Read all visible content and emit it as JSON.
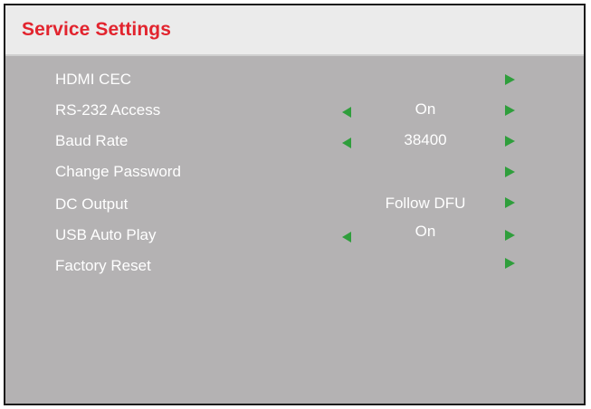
{
  "window": {
    "title": "Service Settings"
  },
  "colors": {
    "title": "#e2242e",
    "header_bg": "#ebebeb",
    "panel_bg": "#b4b2b3",
    "arrow": "#2f9e3c",
    "text": "#ffffff"
  },
  "menu": {
    "items": [
      {
        "label": "HDMI CEC",
        "value": "",
        "left_arrow": false,
        "right_arrow": true
      },
      {
        "label": "RS-232 Access",
        "value": "On",
        "left_arrow": true,
        "right_arrow": true
      },
      {
        "label": "Baud Rate",
        "value": "38400",
        "left_arrow": true,
        "right_arrow": true
      },
      {
        "label": "Change Password",
        "value": "",
        "left_arrow": false,
        "right_arrow": true
      },
      {
        "label": "DC Output",
        "value": "Follow DFU",
        "left_arrow": false,
        "right_arrow": true
      },
      {
        "label": "USB Auto Play",
        "value": "On",
        "left_arrow": true,
        "right_arrow": true
      },
      {
        "label": "Factory Reset",
        "value": "",
        "left_arrow": false,
        "right_arrow": true
      }
    ]
  }
}
